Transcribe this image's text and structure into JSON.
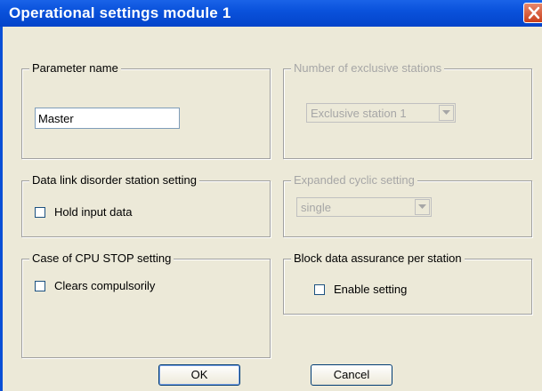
{
  "window": {
    "title": "Operational settings  module 1"
  },
  "parameter_name": {
    "legend": "Parameter name",
    "value": "Master"
  },
  "exclusive_stations": {
    "legend": "Number of exclusive stations",
    "selected": "Exclusive station 1"
  },
  "data_link_disorder": {
    "legend": "Data link disorder station setting",
    "checkbox_label": "Hold input data"
  },
  "expanded_cyclic": {
    "legend": "Expanded cyclic setting",
    "selected": "single"
  },
  "cpu_stop": {
    "legend": "Case of CPU STOP setting",
    "checkbox_label": "Clears compulsorily"
  },
  "block_assurance": {
    "legend": "Block data assurance per station",
    "checkbox_label": "Enable setting"
  },
  "buttons": {
    "ok": "OK",
    "cancel": "Cancel"
  }
}
